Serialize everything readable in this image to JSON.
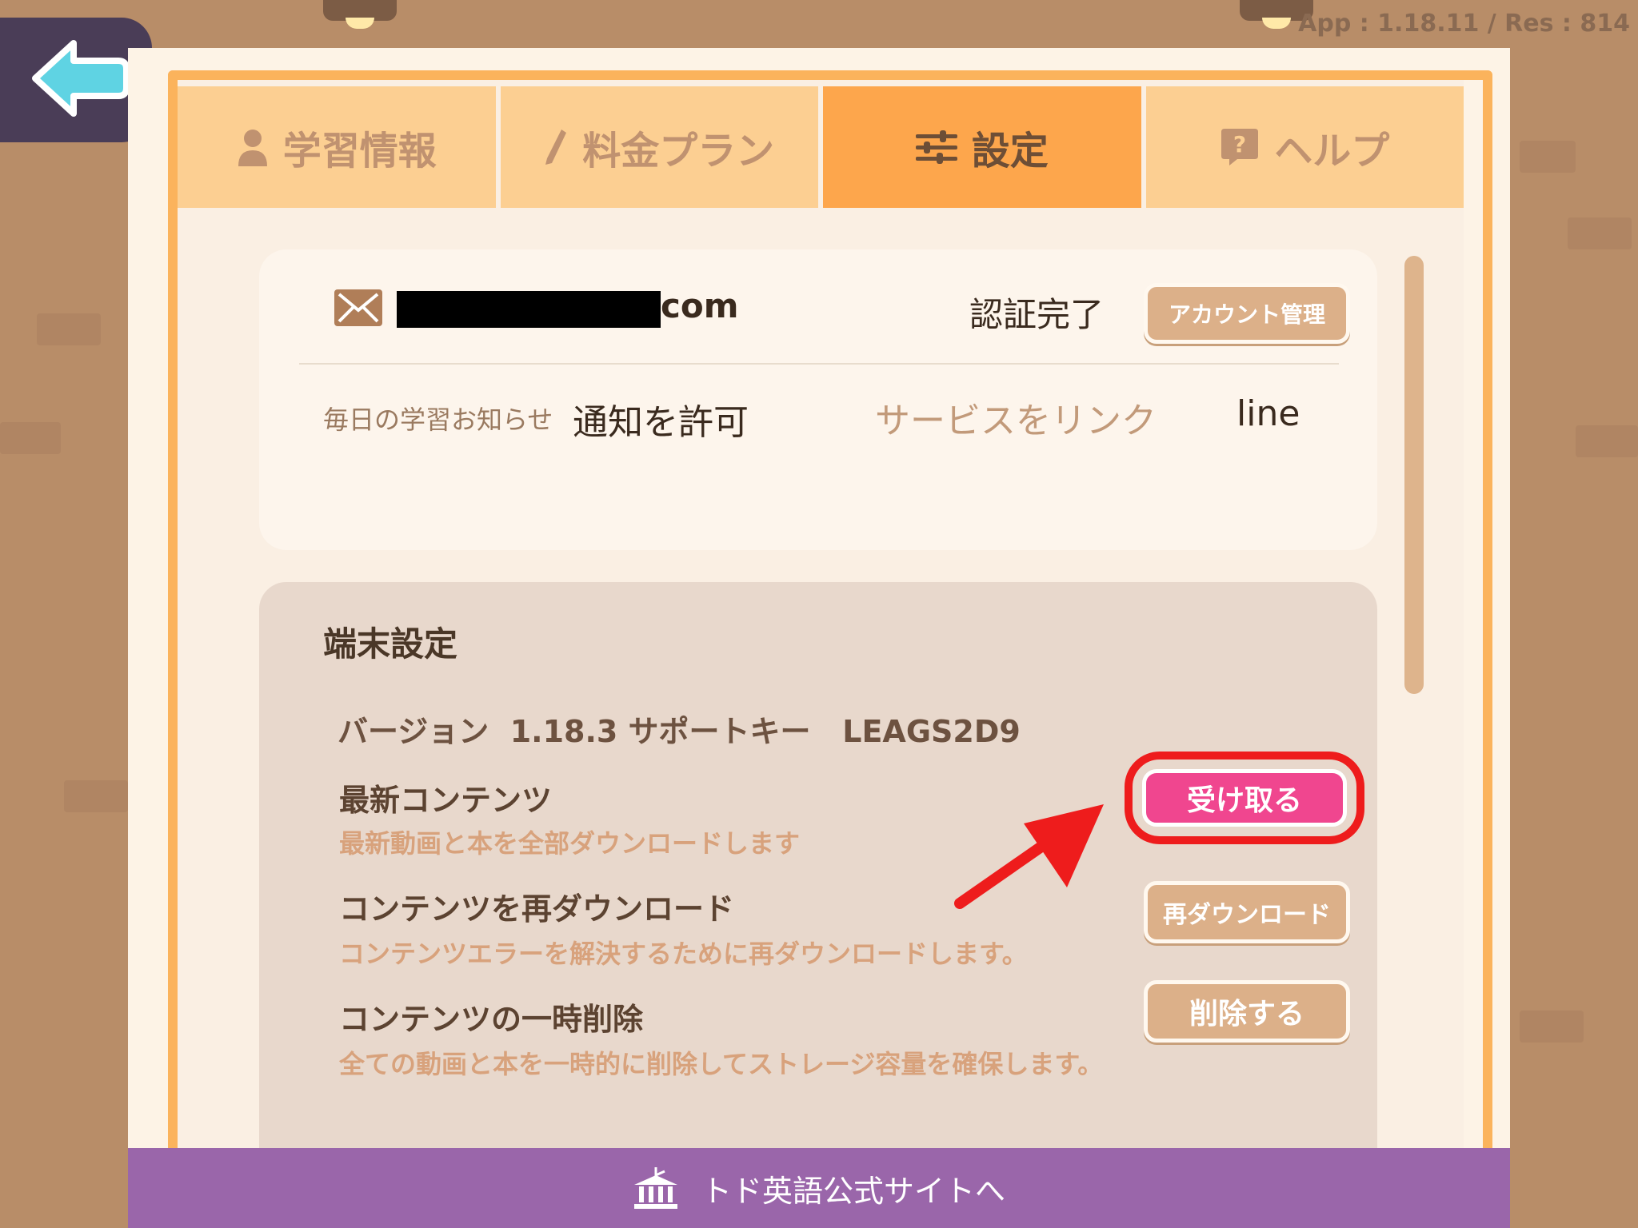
{
  "app_version": "App : 1.18.11 / Res : 814",
  "tabs": [
    {
      "label": "学習情報",
      "icon": "person-icon"
    },
    {
      "label": "料金プラン",
      "icon": "pencil-icon"
    },
    {
      "label": "設定",
      "icon": "sliders-icon",
      "active": true
    },
    {
      "label": "ヘルプ",
      "icon": "help-icon"
    }
  ],
  "account": {
    "email_suffix": "com",
    "verified": "認証完了",
    "manage_button": "アカウント管理",
    "daily_label": "毎日の学習お知らせ",
    "notify_value": "通知を許可",
    "link_service": "サービスをリンク",
    "link_value": "line"
  },
  "device": {
    "title": "端末設定",
    "version_row": "バージョン  1.18.3 サポートキー   LEAGS2D9",
    "items": [
      {
        "title": "最新コンテンツ",
        "desc": "最新動画と本を全部ダウンロードします",
        "button": "受け取る"
      },
      {
        "title": "コンテンツを再ダウンロード",
        "desc": "コンテンツエラーを解決するために再ダウンロードします。",
        "button": "再ダウンロード"
      },
      {
        "title": "コンテンツの一時削除",
        "desc": "全ての動画と本を一時的に削除してストレージ容量を確保します。",
        "button": "削除する"
      }
    ]
  },
  "footer": {
    "label": "トド英語公式サイトへ",
    "icon": "building-icon"
  },
  "colors": {
    "accent": "#fda64c",
    "pink": "#f0468f",
    "highlight": "#ee1c1c",
    "footer": "#9a66aa"
  }
}
